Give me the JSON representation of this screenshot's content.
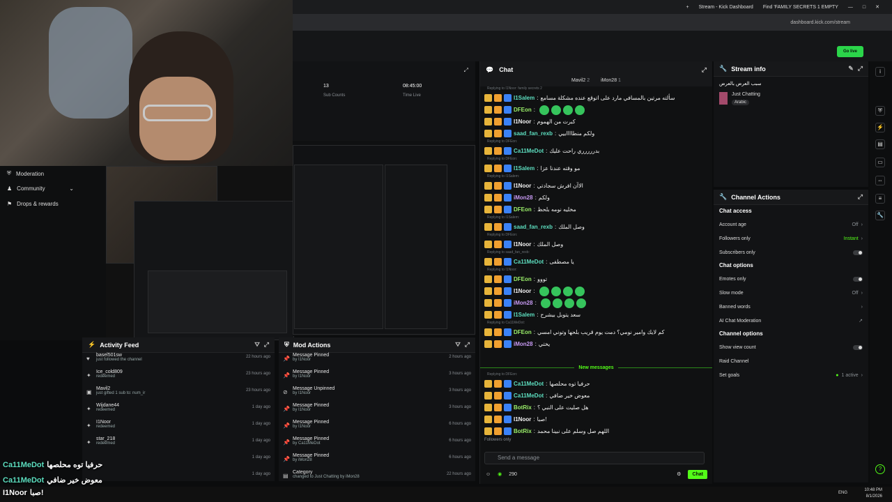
{
  "browser": {
    "tab1": "Stream - Kick Dashboard",
    "tab2": "Find 'FAMILY SECRETS 1 EMPTY",
    "url": "dashboard.kick.com/stream"
  },
  "dashboard": {
    "go_live": "Go live"
  },
  "nav": {
    "moderation": "Moderation",
    "community": "Community",
    "drops": "Drops & rewards"
  },
  "stats": {
    "subs_value": "13",
    "subs_label": "Sub Counts",
    "time_value": "08:45:00",
    "time_label": "Time Live"
  },
  "activity": {
    "title": "Activity Feed",
    "items": [
      {
        "user": "basel501sw",
        "sub": "just followed the channel",
        "time": "22 hours ago"
      },
      {
        "user": "Ice_cold809",
        "sub": "redeemed",
        "time": "23 hours ago"
      },
      {
        "user": "Mavil2",
        "sub": "just gifted 1 sub to: num_ir",
        "time": "23 hours ago"
      },
      {
        "user": "Wijdane44",
        "sub": "redeemed",
        "time": "1 day ago"
      },
      {
        "user": "I1Noor",
        "sub": "redeemed",
        "time": "1 day ago"
      },
      {
        "user": "star_218",
        "sub": "redeemed",
        "time": "1 day ago"
      },
      {
        "user": "",
        "sub": "",
        "time": "1 day ago"
      },
      {
        "user": "",
        "sub": "",
        "time": "1 day ago"
      }
    ]
  },
  "mod": {
    "title": "Mod Actions",
    "items": [
      {
        "action": "Message Pinned",
        "by": "by I1Noor",
        "time": "2 hours ago"
      },
      {
        "action": "Message Pinned",
        "by": "by I1Noor",
        "time": "3 hours ago"
      },
      {
        "action": "Message Unpinned",
        "by": "by I1Noor",
        "time": "3 hours ago"
      },
      {
        "action": "Message Pinned",
        "by": "by I1Noor",
        "time": "3 hours ago"
      },
      {
        "action": "Message Pinned",
        "by": "by I1Noor",
        "time": "6 hours ago"
      },
      {
        "action": "Message Pinned",
        "by": "by Ca11MeDot",
        "time": "6 hours ago"
      },
      {
        "action": "Message Pinned",
        "by": "by iMon28",
        "time": "6 hours ago"
      },
      {
        "action": "Category",
        "by": "changed to Just Chatting by iMon28",
        "time": "22 hours ago"
      }
    ]
  },
  "chat": {
    "title": "Chat",
    "pin1": "Mavil2",
    "pin1_count": "2",
    "pin2": "iMon28",
    "pin2_count": "1",
    "messages": [
      {
        "reply": "Replying to I1Noor: family secrets 2",
        "user": "I1Salem",
        "cls": "u-teal",
        "text": "سألته مرتين بالمسافي مارد على اتوقع عنده مشكلة مسامع"
      },
      {
        "reply": "",
        "user": "DFEon",
        "cls": "u-green",
        "text": ""
      },
      {
        "reply": "",
        "user": "I1Noor",
        "cls": "u-white",
        "text": "كبرت من الهموم"
      },
      {
        "reply": "",
        "user": "saad_fan_rexb",
        "cls": "u-teal",
        "text": "ولكم منطاااابيي"
      },
      {
        "reply": "Replying to DFEon:",
        "user": "Ca11MeDot",
        "cls": "u-teal",
        "text": "بدررررري راحت عليك"
      },
      {
        "reply": "Replying to DFEon:",
        "user": "I1Salem",
        "cls": "u-teal",
        "text": "مو وقته عندنا عزا"
      },
      {
        "reply": "Replying to I1Salem:",
        "user": "I1Noor",
        "cls": "u-white",
        "text": "الاآن افرش سجادتي"
      },
      {
        "reply": "",
        "user": "iMon28",
        "cls": "u-purple",
        "text": "ولكم"
      },
      {
        "reply": "",
        "user": "DFEon",
        "cls": "u-green",
        "text": "مخليه نومه بلحظ"
      },
      {
        "reply": "Replying to I1Salem:",
        "user": "saad_fan_rexb",
        "cls": "u-teal",
        "text": "وصل الملك"
      },
      {
        "reply": "Replying to DFEon:",
        "user": "I1Noor",
        "cls": "u-white",
        "text": "وصل الملك"
      },
      {
        "reply": "Replying to saad_fan_rexb:",
        "user": "Ca11MeDot",
        "cls": "u-teal",
        "text": "يا مصطفى"
      },
      {
        "reply": "Replying to I1Noor:",
        "user": "DFEon",
        "cls": "u-green",
        "text": "تووو"
      },
      {
        "reply": "",
        "user": "I1Noor",
        "cls": "u-white",
        "text": ""
      },
      {
        "reply": "",
        "user": "iMon28",
        "cls": "u-purple",
        "text": ""
      },
      {
        "reply": "",
        "user": "I1Salem",
        "cls": "u-teal",
        "text": "سعد يتوبل بيشرح"
      },
      {
        "reply": "Replying to Ca11MeDot:",
        "user": "DFEon",
        "cls": "u-green",
        "text": "كم لايك وامير نومي؟ دمت يوم قريب بلحها وتوني امسي"
      },
      {
        "reply": "",
        "user": "iMon28",
        "cls": "u-purple",
        "text": "يختي"
      }
    ],
    "new_label": "New messages",
    "new_messages": [
      {
        "reply": "Replying to DFEon:",
        "user": "Ca11MeDot",
        "cls": "u-teal",
        "text": "حرفيا توه محلصها"
      },
      {
        "reply": "",
        "user": "Ca11MeDot",
        "cls": "u-teal",
        "text": "معوض خير ضافي"
      },
      {
        "reply": "",
        "user": "BotRix",
        "cls": "u-green",
        "text": "هل صليت على النبي ؟"
      },
      {
        "reply": "",
        "user": "I1Noor",
        "cls": "u-white",
        "text": "صبا!"
      },
      {
        "reply": "",
        "user": "BotRix",
        "cls": "u-green",
        "text": "اللهم صل وسلم على نبينا محمد"
      }
    ],
    "followers_only": "Followers only",
    "placeholder": "Send a message",
    "points": "290",
    "send": "Chat"
  },
  "streaminfo": {
    "title": "Stream info",
    "stream_title": "سبب العرض بالعرض",
    "category": "Just Chatting",
    "tag": "Arabic"
  },
  "channel": {
    "title": "Channel Actions",
    "chat_access": "Chat access",
    "account_age": "Account age",
    "account_age_val": "Off",
    "followers_only": "Followers only",
    "followers_only_val": "Instant",
    "subscribers_only": "Subscribers only",
    "chat_options": "Chat options",
    "emotes_only": "Emotes only",
    "slow_mode": "Slow mode",
    "slow_mode_val": "Off",
    "banned_words": "Banned words",
    "ai_mod": "AI Chat Moderation",
    "channel_options": "Channel options",
    "show_view_count": "Show view count",
    "raid_channel": "Raid Channel",
    "set_goals": "Set goals",
    "set_goals_val": "1 active"
  },
  "overlay": {
    "l1": "Ca11MeDot",
    "l1t": "حرفيا توه محلصها",
    "l2": "Ca11MeDot",
    "l2t": "معوض خير ضافي",
    "l3": "I1Noor",
    "l3t": "صبا!"
  },
  "taskbar": {
    "lang": "ENG",
    "time": "10:48 PM",
    "date": "8/1/2026"
  }
}
